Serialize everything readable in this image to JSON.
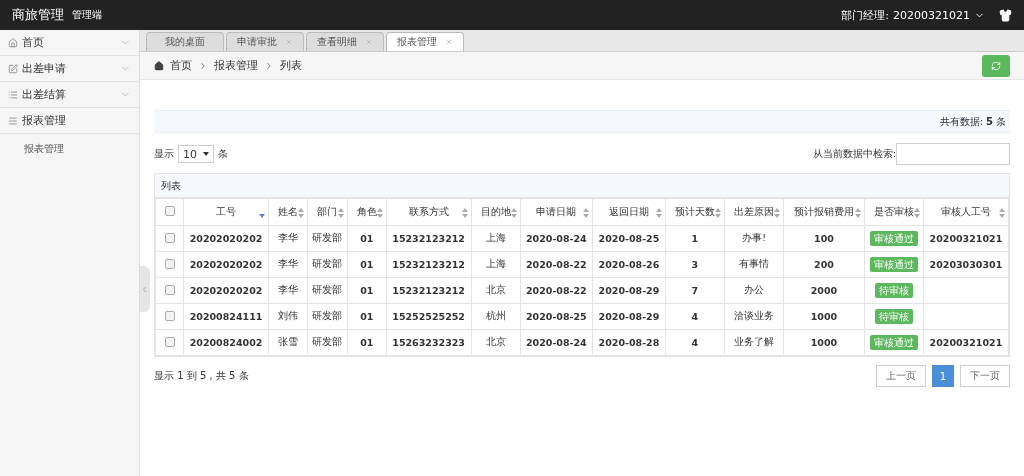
{
  "header": {
    "brand": "商旅管理",
    "subtitle": "管理端",
    "user_label": "部门经理:",
    "user_id": "20200321021"
  },
  "sidebar": {
    "items": [
      {
        "label": "首页",
        "expanded": false
      },
      {
        "label": "出差申请",
        "expanded": false
      },
      {
        "label": "出差结算",
        "expanded": false
      },
      {
        "label": "报表管理",
        "expanded": true,
        "children": [
          {
            "label": "报表管理"
          }
        ]
      }
    ]
  },
  "tabs": [
    {
      "label": "我的桌面",
      "closable": false,
      "selected": false
    },
    {
      "label": "申请审批",
      "closable": true,
      "selected": false
    },
    {
      "label": "查看明细",
      "closable": true,
      "selected": false
    },
    {
      "label": "报表管理",
      "closable": true,
      "selected": true
    }
  ],
  "breadcrumb": [
    "首页",
    "报表管理",
    "列表"
  ],
  "summary": {
    "label": "共有数据:",
    "count": "5",
    "unit": "条"
  },
  "page_size": {
    "prefix": "显示",
    "value": "10",
    "suffix": "条"
  },
  "search": {
    "label": "从当前数据中检索:"
  },
  "table": {
    "title": "列表",
    "all_checked": false,
    "columns": [
      {
        "label": "工号",
        "sorted": true
      },
      {
        "label": "姓名",
        "sorted": false
      },
      {
        "label": "部门",
        "sorted": false
      },
      {
        "label": "角色",
        "sorted": false
      },
      {
        "label": "联系方式",
        "sorted": false
      },
      {
        "label": "目的地",
        "sorted": false
      },
      {
        "label": "申请日期",
        "sorted": false
      },
      {
        "label": "返回日期",
        "sorted": false
      },
      {
        "label": "预计天数",
        "sorted": false
      },
      {
        "label": "出差原因",
        "sorted": false
      },
      {
        "label": "预计报销费用",
        "sorted": false
      },
      {
        "label": "是否审核",
        "sorted": false
      },
      {
        "label": "审核人工号",
        "sorted": false
      }
    ],
    "rows": [
      {
        "checked": false,
        "cells": [
          "20202020202",
          "李华",
          "研发部",
          "01",
          "15232123212",
          "上海",
          "2020-08-24",
          "2020-08-25",
          "1",
          "办事!",
          "100",
          "审核通过",
          "20200321021"
        ]
      },
      {
        "checked": false,
        "cells": [
          "20202020202",
          "李华",
          "研发部",
          "01",
          "15232123212",
          "上海",
          "2020-08-22",
          "2020-08-26",
          "3",
          "有事情",
          "200",
          "审核通过",
          "20203030301"
        ]
      },
      {
        "checked": false,
        "cells": [
          "20202020202",
          "李华",
          "研发部",
          "01",
          "15232123212",
          "北京",
          "2020-08-22",
          "2020-08-29",
          "7",
          "办公",
          "2000",
          "待审核",
          ""
        ]
      },
      {
        "checked": false,
        "cells": [
          "20200824111",
          "刘伟",
          "研发部",
          "01",
          "15252525252",
          "杭州",
          "2020-08-25",
          "2020-08-29",
          "4",
          "洽谈业务",
          "1000",
          "待审核",
          ""
        ]
      },
      {
        "checked": false,
        "cells": [
          "20200824002",
          "张雪",
          "研发部",
          "01",
          "15263232323",
          "北京",
          "2020-08-24",
          "2020-08-28",
          "4",
          "业务了解",
          "1000",
          "审核通过",
          "20200321021"
        ]
      }
    ]
  },
  "footer": {
    "info": "显示 1 到 5 , 共 5 条",
    "pages": [
      {
        "label": "上一页",
        "kind": "nav",
        "selected": false
      },
      {
        "label": "1",
        "kind": "page",
        "selected": true
      },
      {
        "label": "下一页",
        "kind": "nav",
        "selected": false
      }
    ]
  }
}
